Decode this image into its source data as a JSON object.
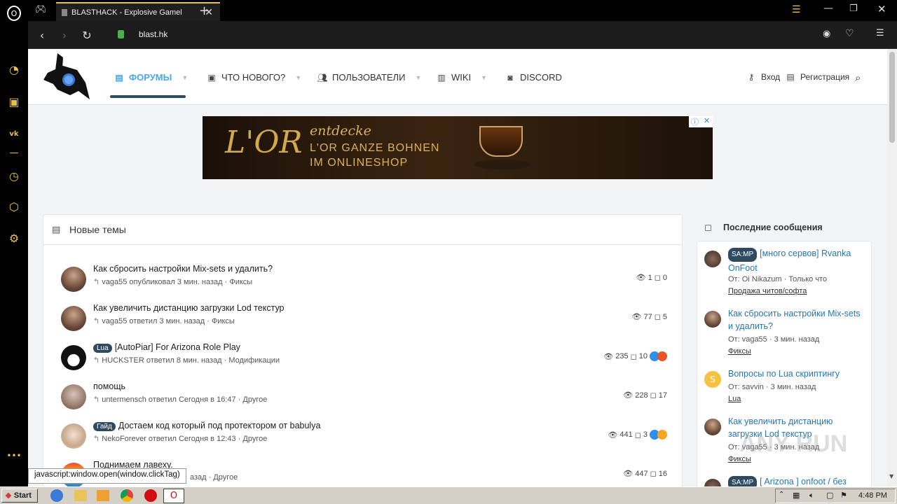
{
  "browser": {
    "tab_title": "BLASTHACK - Explosive Gamel",
    "url": "blast.hk",
    "status_url": "javascript:window.open(window.clickTag)"
  },
  "nav": {
    "forums": "ФОРУМЫ",
    "whats_new": "ЧТО НОВОГО?",
    "members": "ПОЛЬЗОВАТЕЛИ",
    "wiki": "WIKI",
    "discord": "DISCORD",
    "login": "Вход",
    "register": "Регистрация"
  },
  "ad": {
    "brand": "L'OR",
    "line1": "entdecke",
    "line2": "L'OR GANZE BOHNEN",
    "line3": "IM ONLINESHOP"
  },
  "new_threads": {
    "title": "Новые темы",
    "rows": [
      {
        "prefix": "",
        "title": "Как сбросить настройки Mix-sets и удалить?",
        "meta": "vaga55 опубликовал 3 мин. назад · Фиксы",
        "views": "1",
        "replies": "0"
      },
      {
        "prefix": "",
        "title": "Как увеличить дистанцию загрузки Lod текстур",
        "meta": "vaga55 ответил 3 мин. назад · Фиксы",
        "views": "77",
        "replies": "5"
      },
      {
        "prefix": "Lua",
        "title": "[AutoPiar] For Arizona Role Play",
        "meta": "HUCKSTER ответил 8 мин. назад · Модификации",
        "views": "235",
        "replies": "10"
      },
      {
        "prefix": "",
        "title": "помощь",
        "meta": "untermensch ответил Сегодня в 16:47 · Другое",
        "views": "228",
        "replies": "17"
      },
      {
        "prefix": "Гайд",
        "title": "Достаем код который под протектором от babulya",
        "meta": "NekoForever ответил Сегодня в 12:43 · Другое",
        "views": "441",
        "replies": "3"
      },
      {
        "prefix": "",
        "title": "Поднимаем лавеху.",
        "meta": "азад · Другое",
        "views": "447",
        "replies": "16"
      }
    ]
  },
  "latest_posts": {
    "title": "Последние сообщения",
    "items": [
      {
        "prefix": "SA:MP",
        "title": "[много сервов] Rvanka OnFoot",
        "meta": "От: Oi Nikazum · Только что",
        "forum": "Продажа читов/софта"
      },
      {
        "prefix": "",
        "title": "Как сбросить настройки Mix-sets и удалить?",
        "meta": "От: vaga55 · 3 мин. назад",
        "forum": "Фиксы"
      },
      {
        "prefix": "",
        "title": "Вопросы по Lua скриптингу",
        "meta": "От: savvin · 3 мин. назад",
        "forum": "Lua",
        "initial": "S"
      },
      {
        "prefix": "",
        "title": "Как увеличить дистанцию загрузки Lod текстур",
        "meta": "От: vaga55 · 3 мин. назад",
        "forum": "Фиксы"
      },
      {
        "prefix": "SA:MP",
        "title": "[ Arizona ] onfoot / без",
        "meta": "",
        "forum": ""
      }
    ]
  },
  "watermark": "ANY RUN",
  "taskbar": {
    "start": "Start",
    "time": "4:48 PM"
  }
}
